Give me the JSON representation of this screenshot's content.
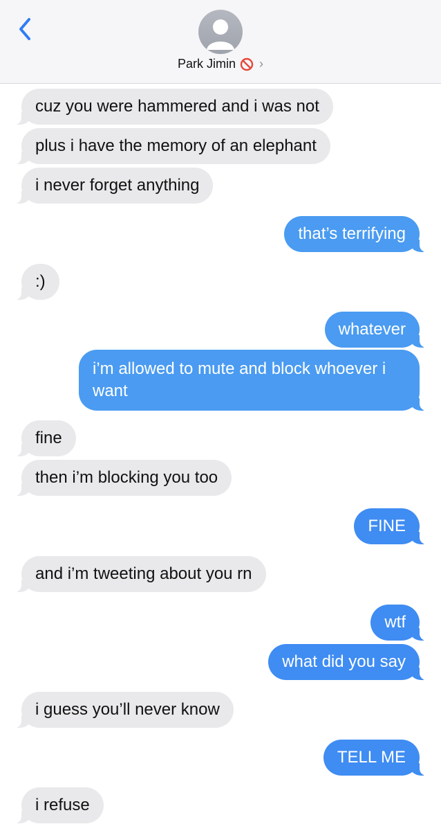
{
  "header": {
    "contact_name": "Park Jimin",
    "blocked_icon": "no-entry-icon",
    "back_icon": "chevron-left-icon",
    "chevron_icon": "chevron-right-icon",
    "chevron_glyph": "›",
    "accent_color": "#2f7cf6"
  },
  "messages": [
    {
      "from": "them",
      "text": "cuz you were hammered and i was not"
    },
    {
      "from": "them",
      "text": "plus i have the memory of an elephant"
    },
    {
      "from": "them",
      "text": "i never forget anything"
    },
    {
      "from": "me",
      "text": "that’s terrifying"
    },
    {
      "from": "them",
      "text": ":)"
    },
    {
      "from": "me",
      "text": "whatever"
    },
    {
      "from": "me",
      "text": "i’m allowed to mute and block whoever i want"
    },
    {
      "from": "them",
      "text": "fine"
    },
    {
      "from": "them",
      "text": "then i’m blocking you too"
    },
    {
      "from": "me",
      "text": "FINE"
    },
    {
      "from": "them",
      "text": "and i’m tweeting about you rn"
    },
    {
      "from": "me",
      "text": "wtf"
    },
    {
      "from": "me",
      "text": "what did you say"
    },
    {
      "from": "them",
      "text": "i guess you’ll never know"
    },
    {
      "from": "me",
      "text": "TELL ME"
    },
    {
      "from": "them",
      "text": "i refuse"
    }
  ]
}
